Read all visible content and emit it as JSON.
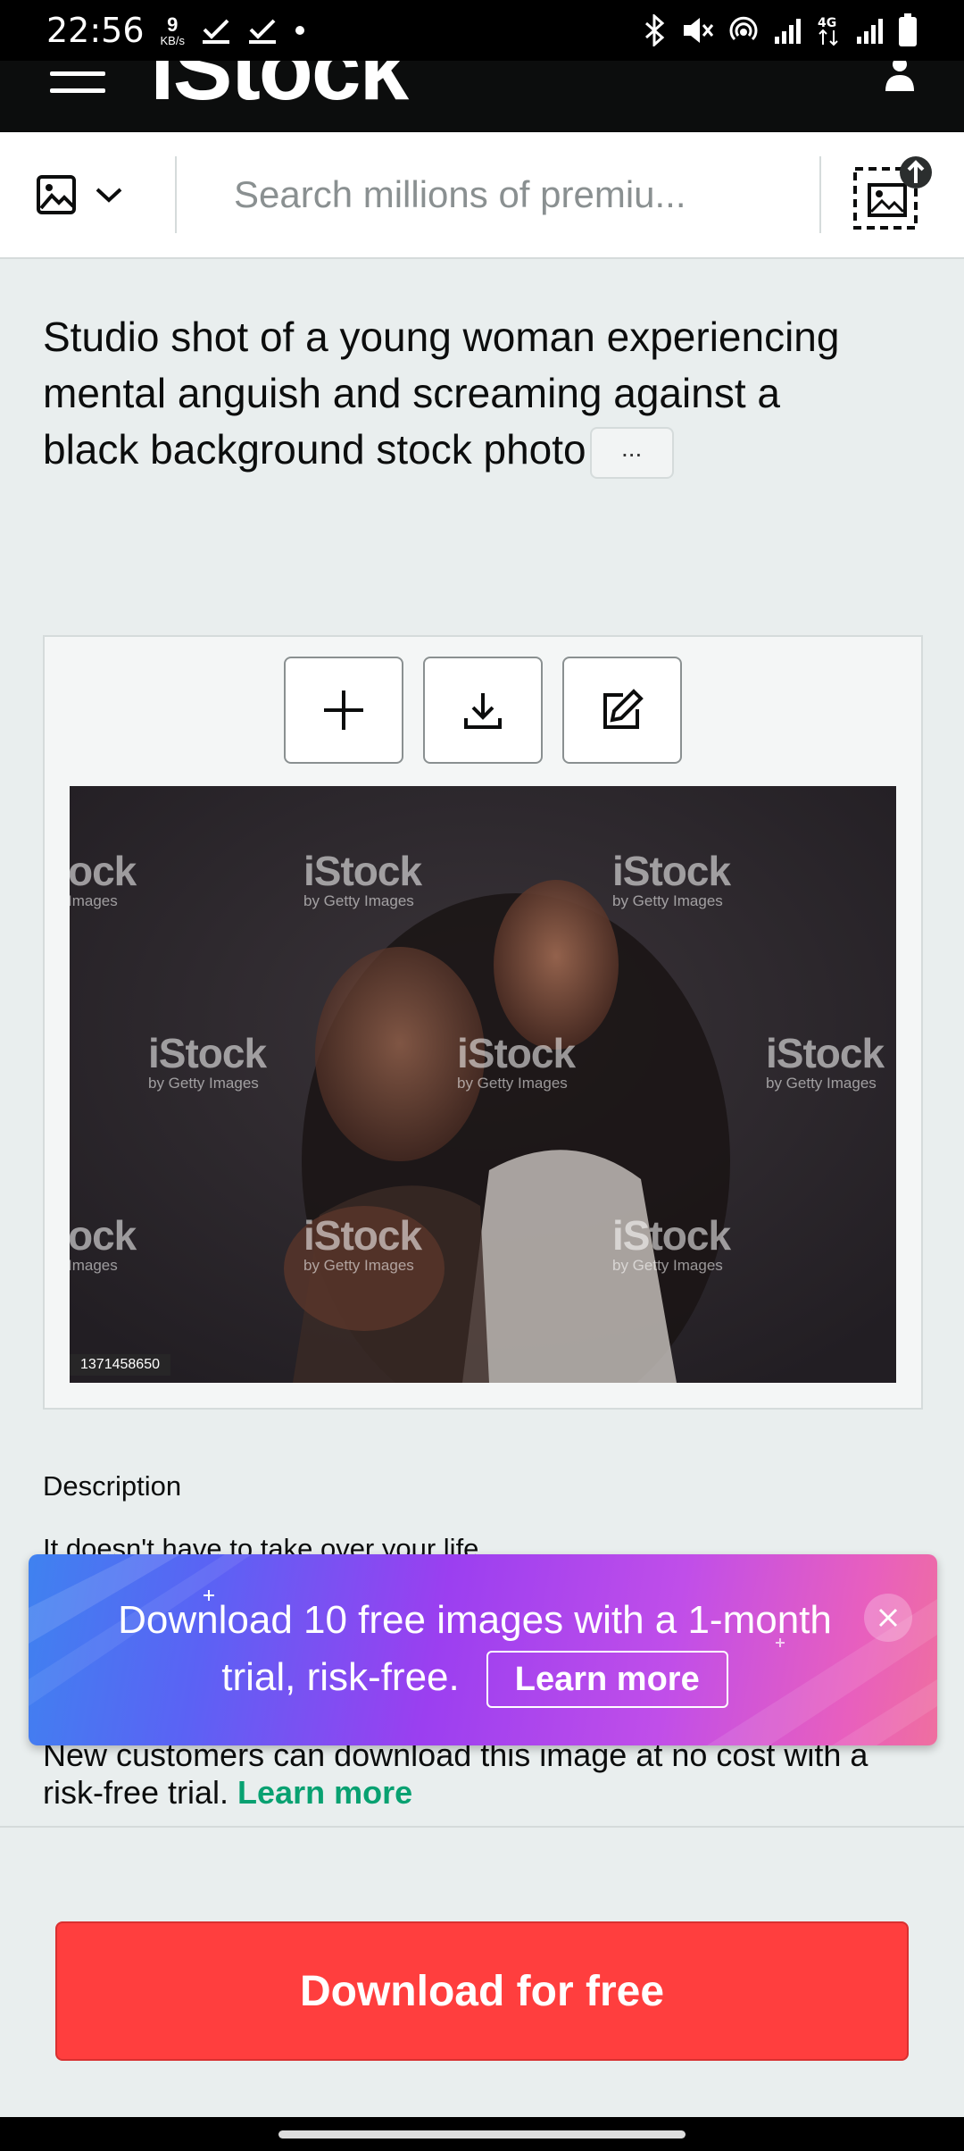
{
  "status_bar": {
    "time": "22:56",
    "net_speed": "9",
    "net_unit": "KB/s"
  },
  "header": {
    "logo": "iStock"
  },
  "search": {
    "placeholder": "Search millions of premiu..."
  },
  "page": {
    "title": "Studio shot of a young woman experiencing mental anguish and screaming against a black background stock photo",
    "more_label": "..."
  },
  "image": {
    "watermark_brand": "iStock",
    "watermark_sub": "by Getty Images",
    "watermark_crop_brand": "ock",
    "watermark_crop_sub": "Images",
    "id": "1371458650"
  },
  "description": {
    "label": "Description",
    "text": "It doesn't have to take over your life"
  },
  "promo": {
    "text": "Download 10 free images with a 1-month trial, risk-free.",
    "learn_more": "Learn more"
  },
  "trial": {
    "text": "New customers can download this image at no cost with a risk-free trial.",
    "link": "Learn more"
  },
  "cta": {
    "download": "Download for free"
  },
  "colors": {
    "download_red": "#ff3e3e",
    "link_green": "#08a171",
    "header_black": "#0c0d0d"
  }
}
